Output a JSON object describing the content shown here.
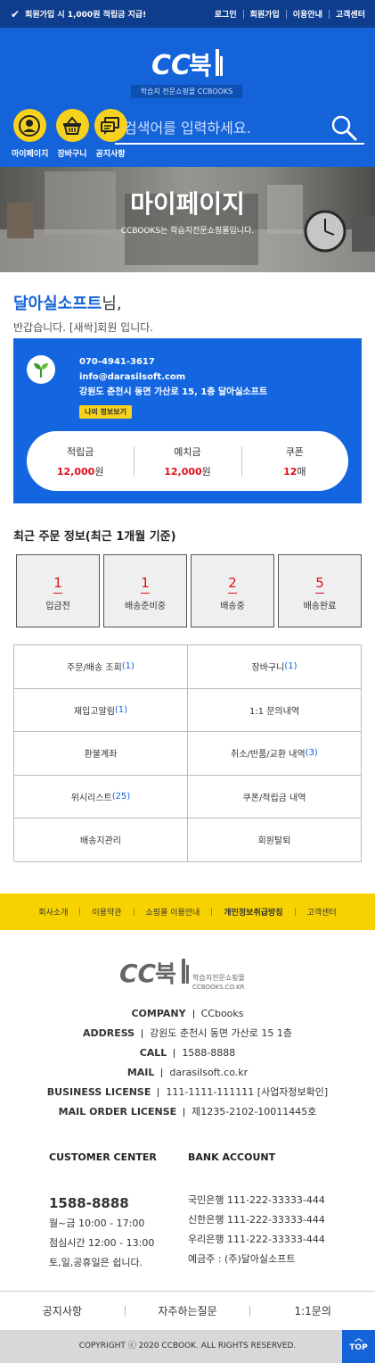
{
  "topbar": {
    "promo": "회원가입 시 1,000원 적립금 지급!",
    "links": [
      "로그인",
      "회원가입",
      "이용안내",
      "고객센터"
    ]
  },
  "header": {
    "logo_text": "CC북",
    "logo_sub": "학습지 전문쇼핑몰 CCBOOKS",
    "quick": [
      {
        "label": "마이페이지",
        "icon": "user-icon"
      },
      {
        "label": "장바구니",
        "icon": "basket-icon"
      },
      {
        "label": "공지사항",
        "icon": "notice-icon"
      }
    ],
    "search_placeholder": "검색어를 입력하세요."
  },
  "hero": {
    "title": "마이페이지",
    "subtitle": "CCBOOKS는 학습지전문쇼핑몰입니다."
  },
  "greeting": {
    "name": "달아실소프트",
    "suffix": "님,",
    "message": "반갑습니다. [새싹]회원 입니다."
  },
  "profile": {
    "phone": "070-4941-3617",
    "email": "info@darasilsoft.com",
    "address": "강원도 춘천시 동면 가산로 15, 1층 달아실소프트",
    "info_button": "나의 정보보기",
    "stats": [
      {
        "label": "적립금",
        "value": "12,000",
        "unit": "원"
      },
      {
        "label": "예치금",
        "value": "12,000",
        "unit": "원"
      },
      {
        "label": "쿠폰",
        "value": "12",
        "unit": "매"
      }
    ]
  },
  "orders": {
    "title": "최근 주문 정보(최근 1개월 기준)",
    "items": [
      {
        "count": "1",
        "label": "입금전"
      },
      {
        "count": "1",
        "label": "배송준비중"
      },
      {
        "count": "2",
        "label": "배송중"
      },
      {
        "count": "5",
        "label": "배송완료"
      }
    ]
  },
  "menu": [
    {
      "label": "주문/배송 조회",
      "count": "(1)"
    },
    {
      "label": "장바구니",
      "count": "(1)"
    },
    {
      "label": "재입고알림",
      "count": "(1)"
    },
    {
      "label": "1:1 문의내역",
      "count": ""
    },
    {
      "label": "환불계좌",
      "count": ""
    },
    {
      "label": "취소/반품/교환 내역",
      "count": "(3)"
    },
    {
      "label": "위시리스트",
      "count": "(25)"
    },
    {
      "label": "쿠폰/적립금 내역",
      "count": ""
    },
    {
      "label": "배송지관리",
      "count": ""
    },
    {
      "label": "회원탈퇴",
      "count": ""
    }
  ],
  "footer_nav": [
    "회사소개",
    "이용약관",
    "쇼핑몰 이용안내",
    "개인정보취급방침",
    "고객센터"
  ],
  "footer_logo": {
    "text": "CC북",
    "sub1": "학습지전문쇼핑몰",
    "sub2": "CCBOOKS.CO.KR"
  },
  "company": [
    {
      "key": "COMPANY",
      "value": "CCbooks"
    },
    {
      "key": "ADDRESS",
      "value": "강원도 춘천시 동면 가산로 15 1층"
    },
    {
      "key": "CALL",
      "value": "1588-8888"
    },
    {
      "key": "MAIL",
      "value": "darasilsoft.co.kr"
    },
    {
      "key": "BUSINESS LICENSE",
      "value": "111-1111-111111 [사업자정보확인]"
    },
    {
      "key": "MAIL ORDER LICENSE",
      "value": "제1235-2102-10011445호"
    }
  ],
  "customer_center": {
    "title": "CUSTOMER CENTER",
    "phone": "1588-8888",
    "lines": [
      "월~금 10:00 - 17:00",
      "점심시간 12:00 - 13:00",
      "토,일,공휴일은 쉽니다."
    ]
  },
  "bank": {
    "title": "BANK ACCOUNT",
    "lines": [
      "국민은행 111-222-33333-444",
      "신한은행 111-222-33333-444",
      "우리은행 111-222-33333-444",
      "예금주 : (주)달아실소프트"
    ]
  },
  "bottom_links": [
    "공지사항",
    "자주하는질문",
    "1:1문의"
  ],
  "copyright": "COPYRIGHT ⓒ 2020 CCBOOK. ALL RIGHTS RESERVED.",
  "top_button": "TOP",
  "colors": {
    "primary": "#1463d8",
    "dark_blue": "#0d3d8c",
    "yellow": "#f7d21c",
    "red": "#e0101c"
  }
}
